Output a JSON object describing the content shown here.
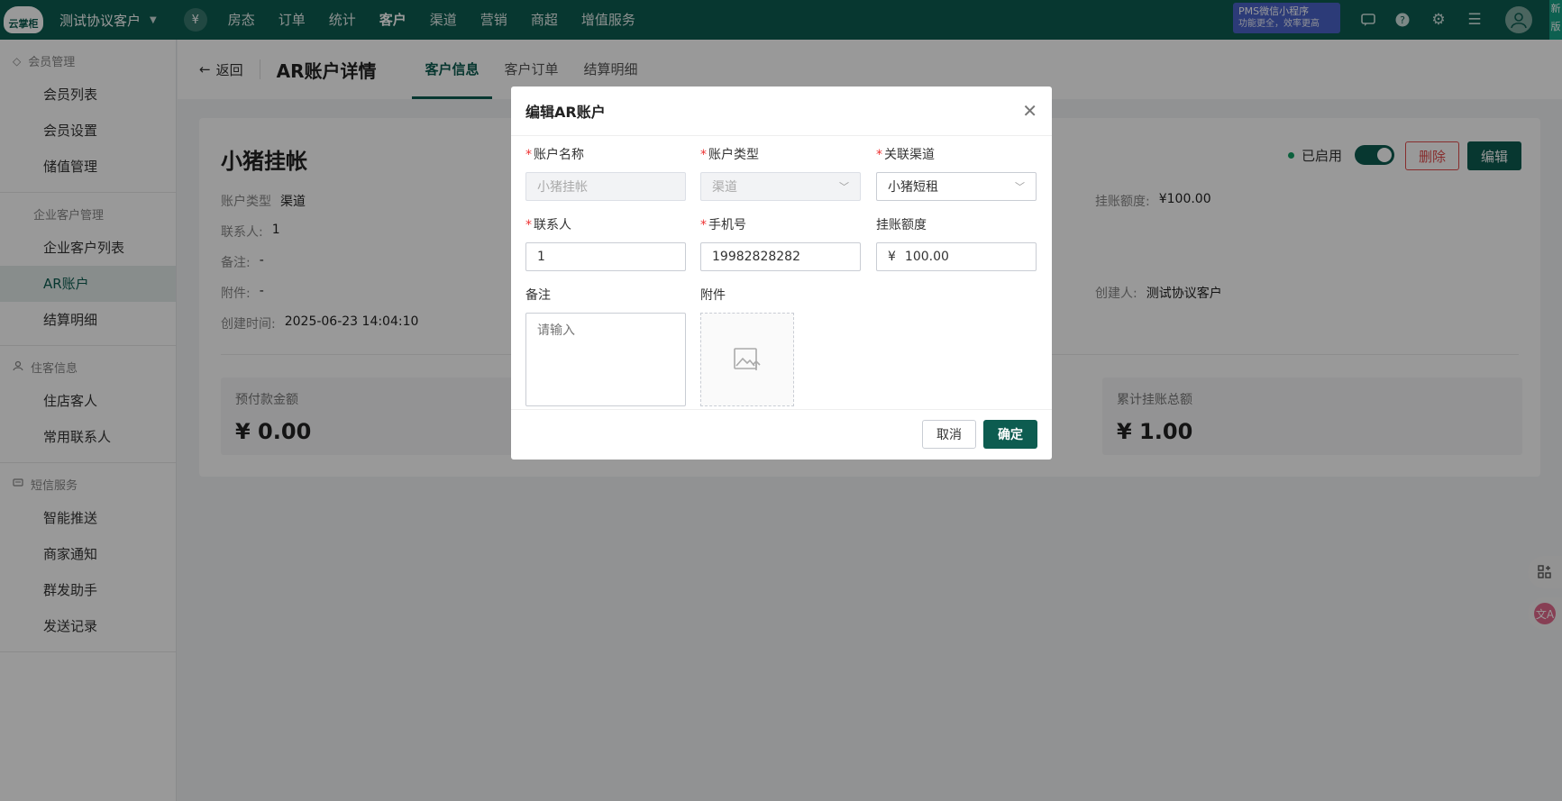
{
  "topbar": {
    "logo_text": "云掌柜",
    "hotel_name": "测试协议客户",
    "yen_symbol": "¥",
    "nav": [
      "房态",
      "订单",
      "统计",
      "客户",
      "渠道",
      "营销",
      "商超",
      "增值服务"
    ],
    "active_nav": "客户",
    "promo_line1": "PMS微信小程序",
    "promo_line2": "功能更全，效率更高",
    "new_tag": "新版"
  },
  "sidebar": {
    "groups": [
      {
        "title": "会员管理",
        "icon": "diamond-icon",
        "items": [
          "会员列表",
          "会员设置",
          "储值管理"
        ]
      },
      {
        "title": "企业客户管理",
        "icon": "",
        "items": [
          "企业客户列表",
          "AR账户",
          "结算明细"
        ]
      },
      {
        "title": "住客信息",
        "icon": "user-icon",
        "items": [
          "住店客人",
          "常用联系人"
        ]
      },
      {
        "title": "短信服务",
        "icon": "message-icon",
        "items": [
          "智能推送",
          "商家通知",
          "群发助手",
          "发送记录"
        ]
      }
    ],
    "active_item": "AR账户"
  },
  "header": {
    "back_label": "返回",
    "title": "AR账户详情",
    "tabs": [
      "客户信息",
      "客户订单",
      "结算明细"
    ],
    "active_tab": "客户信息"
  },
  "account": {
    "name": "小猪挂帐",
    "status_label": "已启用",
    "delete_label": "删除",
    "edit_label": "编辑",
    "type_label": "账户类型",
    "type_value": "渠道",
    "contact_label": "联系人:",
    "contact_value": "1",
    "remark_label": "备注:",
    "remark_value": "-",
    "attachment_label": "附件:",
    "attachment_value": "-",
    "created_label": "创建时间:",
    "created_value": "2025-06-23 14:04:10",
    "credit_label": "挂账额度:",
    "credit_value": "¥100.00",
    "creator_label": "创建人:",
    "creator_value": "测试协议客户"
  },
  "stats": [
    {
      "label": "预付款金额",
      "value": "¥ 0.00"
    },
    {
      "label": "累计挂账总额",
      "value": "¥ 1.00"
    }
  ],
  "dialog": {
    "title": "编辑AR账户",
    "fields": {
      "account_name": {
        "label": "账户名称",
        "placeholder": "小猪挂帐"
      },
      "account_type": {
        "label": "账户类型",
        "value": "渠道"
      },
      "channel": {
        "label": "关联渠道",
        "value": "小猪短租"
      },
      "contact": {
        "label": "联系人",
        "value": "1"
      },
      "phone": {
        "label": "手机号",
        "value": "19982828282"
      },
      "credit": {
        "label": "挂账额度",
        "prefix": "¥",
        "value": "100.00"
      },
      "remark": {
        "label": "备注",
        "placeholder": "请输入"
      },
      "attachment": {
        "label": "附件"
      }
    },
    "cancel_label": "取消",
    "confirm_label": "确定"
  },
  "colors": {
    "brand": "#0d5c50",
    "danger": "#e24b4b",
    "required": "#e33333",
    "promo": "#4a63c9"
  }
}
